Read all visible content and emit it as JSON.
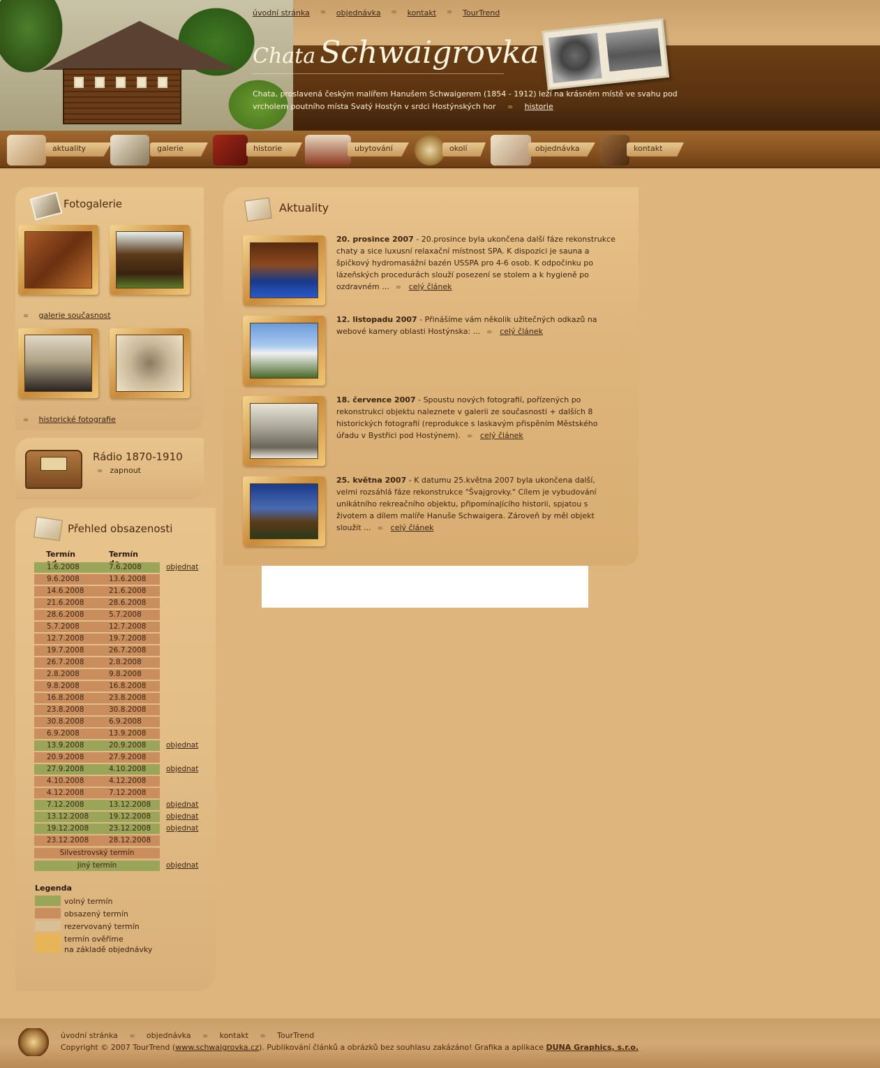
{
  "header": {
    "top_links": [
      "úvodní stránka",
      "objednávka",
      "kontakt",
      "TourTrend"
    ],
    "logo_small": "Chata",
    "logo_big": "Schwaigrovka",
    "description": "Chata, proslavená českým malířem Hanušem Schwaigerem (1854 - 1912) leží na krásném místě ve svahu pod vrcholem poutního místa Svatý Hostýn v srdci Hostýnských hor",
    "description_link": "historie"
  },
  "nav": [
    "aktuality",
    "galerie",
    "historie",
    "ubytování",
    "okolí",
    "objednávka",
    "kontakt"
  ],
  "gallery": {
    "title": "Fotogalerie",
    "link_current": "galerie současnost",
    "link_historic": "historické fotografie"
  },
  "radio": {
    "title": "Rádio 1870-1910",
    "action": "zapnout"
  },
  "occupancy": {
    "title": "Přehled obsazenosti",
    "col_from": "Termín od",
    "col_to": "Termín do",
    "order_label": "objednat",
    "rows": [
      {
        "from": "1.6.2008",
        "to": "7.6.2008",
        "status": "free"
      },
      {
        "from": "9.6.2008",
        "to": "13.6.2008",
        "status": "busy"
      },
      {
        "from": "14.6.2008",
        "to": "21.6.2008",
        "status": "busy"
      },
      {
        "from": "21.6.2008",
        "to": "28.6.2008",
        "status": "busy"
      },
      {
        "from": "28.6.2008",
        "to": "5.7.2008",
        "status": "busy"
      },
      {
        "from": "5.7.2008",
        "to": "12.7.2008",
        "status": "busy"
      },
      {
        "from": "12.7.2008",
        "to": "19.7.2008",
        "status": "busy"
      },
      {
        "from": "19.7.2008",
        "to": "26.7.2008",
        "status": "busy"
      },
      {
        "from": "26.7.2008",
        "to": "2.8.2008",
        "status": "busy"
      },
      {
        "from": "2.8.2008",
        "to": "9.8.2008",
        "status": "busy"
      },
      {
        "from": "9.8.2008",
        "to": "16.8.2008",
        "status": "busy"
      },
      {
        "from": "16.8.2008",
        "to": "23.8.2008",
        "status": "busy"
      },
      {
        "from": "23.8.2008",
        "to": "30.8.2008",
        "status": "busy"
      },
      {
        "from": "30.8.2008",
        "to": "6.9.2008",
        "status": "busy"
      },
      {
        "from": "6.9.2008",
        "to": "13.9.2008",
        "status": "busy"
      },
      {
        "from": "13.9.2008",
        "to": "20.9.2008",
        "status": "free"
      },
      {
        "from": "20.9.2008",
        "to": "27.9.2008",
        "status": "busy"
      },
      {
        "from": "27.9.2008",
        "to": "4.10.2008",
        "status": "free"
      },
      {
        "from": "4.10.2008",
        "to": "4.12.2008",
        "status": "busy"
      },
      {
        "from": "4.12.2008",
        "to": "7.12.2008",
        "status": "busy"
      },
      {
        "from": "7.12.2008",
        "to": "13.12.2008",
        "status": "free"
      },
      {
        "from": "13.12.2008",
        "to": "19.12.2008",
        "status": "free"
      },
      {
        "from": "19.12.2008",
        "to": "23.12.2008",
        "status": "free"
      },
      {
        "from": "23.12.2008",
        "to": "28.12.2008",
        "status": "busy"
      }
    ],
    "special_rows": [
      {
        "label": "Silvestrovský termín",
        "status": "busy"
      },
      {
        "label": "jiný termín",
        "status": "free"
      }
    ]
  },
  "legend": {
    "title": "Legenda",
    "items": [
      {
        "label": "volný termín",
        "color": "#9aa55a"
      },
      {
        "label": "obsazený termín",
        "color": "#c98d5e"
      },
      {
        "label": "rezervovaný termín",
        "color": "#d8bf96"
      },
      {
        "label": "termín ověříme",
        "label2": "na základě objednávky",
        "color": "#e8b458"
      }
    ]
  },
  "news": {
    "title": "Aktuality",
    "read_more": "celý článek",
    "items": [
      {
        "date": "20. prosince 2007",
        "text": "20.prosince byla ukončena další fáze rekonstrukce chaty a sice luxusní relaxační místnost SPA. K dispozici je sauna a špičkový hydromasážní bazén USSPA pro 4-6 osob. K odpočinku po lázeňských procedurách slouží posezení se stolem a k hygieně po ozdravném ..."
      },
      {
        "date": "12. listopadu 2007",
        "text": "Přinášíme vám několik užitečných odkazů na webové kamery oblasti Hostýnska: ..."
      },
      {
        "date": "18. července 2007",
        "text": "Spoustu nových fotografií, pořízených po rekonstrukci objektu naleznete v galerii ze současnosti + dalších 8 historických fotografií (reprodukce s laskavým přispěním Městského úřadu v Bystřici pod Hostýnem)."
      },
      {
        "date": "25. května 2007",
        "text": "K datumu 25.května 2007 byla ukončena další, velmi rozsáhlá fáze rekonstrukce \"Švajgrovky.\" Cílem je vybudování unikátního rekreačního objektu, připomínajícího historii, spjatou s životem a dílem malíře Hanuše Schwaigera. Zároveň by měl objekt sloužit ..."
      }
    ]
  },
  "footer": {
    "links": [
      "úvodní stránka",
      "objednávka",
      "kontakt",
      "TourTrend"
    ],
    "copyright_prefix": "Copyright © 2007 TourTrend (",
    "copyright_url": "www.schwaigrovka.cz",
    "copyright_middle": "). Publikování článků a obrázků bez souhlasu zakázáno! Grafika a aplikace ",
    "copyright_author": "DUNA Graphics, s.r.o."
  },
  "colors": {
    "free": "#9aa55a",
    "busy": "#c98d5e",
    "background": "#deb57c",
    "header_band": "#5a3310"
  }
}
